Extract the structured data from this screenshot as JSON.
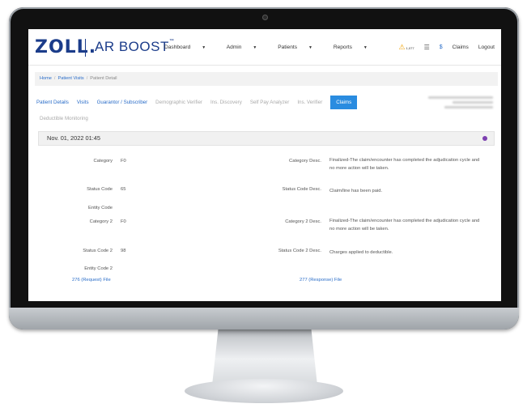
{
  "brand": {
    "logo": "ZOLL",
    "product": "AR BOOST"
  },
  "nav": {
    "items": [
      {
        "label": "Dashboard"
      },
      {
        "label": "Admin"
      },
      {
        "label": "Patients"
      },
      {
        "label": "Reports"
      }
    ],
    "warning_count": "1,077",
    "dollar": "$",
    "claims": "Claims",
    "logout": "Logout"
  },
  "breadcrumb": {
    "home": "Home",
    "visits": "Patient Visits",
    "current": "Patient Detail"
  },
  "tabs": [
    {
      "label": "Patient Details"
    },
    {
      "label": "Visits"
    },
    {
      "label": "Guarantor / Subscriber"
    },
    {
      "label": "Demographic Verifier"
    },
    {
      "label": "Ins. Discovery"
    },
    {
      "label": "Self Pay Analyzer"
    },
    {
      "label": "Ins. Verifier"
    },
    {
      "label": "Claims"
    }
  ],
  "tab_row2": "Deductible Monitoring",
  "section": {
    "date": "Nov. 01, 2022 01:45"
  },
  "fields": {
    "category_label": "Category",
    "category_value": "F0",
    "category_desc_label": "Category Desc.",
    "category_desc_value": "Finalized-The claim/encounter has completed the adjudication cycle and no more action will be taken.",
    "status_code_label": "Status Code",
    "status_code_value": "65",
    "status_code_desc_label": "Status Code Desc.",
    "status_code_desc_value": "Claim/line has been paid.",
    "entity_code_label": "Entity Code",
    "category2_label": "Category 2",
    "category2_value": "F0",
    "category2_desc_label": "Category 2 Desc.",
    "category2_desc_value": "Finalized-The claim/encounter has completed the adjudication cycle and no more action will be taken.",
    "status_code2_label": "Status Code 2",
    "status_code2_value": "98",
    "status_code2_desc_label": "Status Code 2 Desc.",
    "status_code2_desc_value": "Charges applied to deductible.",
    "entity_code2_label": "Entity Code 2"
  },
  "files": {
    "request": "276 (Request) File",
    "response": "277 (Response) File"
  },
  "colors": {
    "brand": "#1b3c8a",
    "link": "#2a6dc8",
    "active_tab": "#2a8ce0",
    "warning": "#f0a000"
  }
}
